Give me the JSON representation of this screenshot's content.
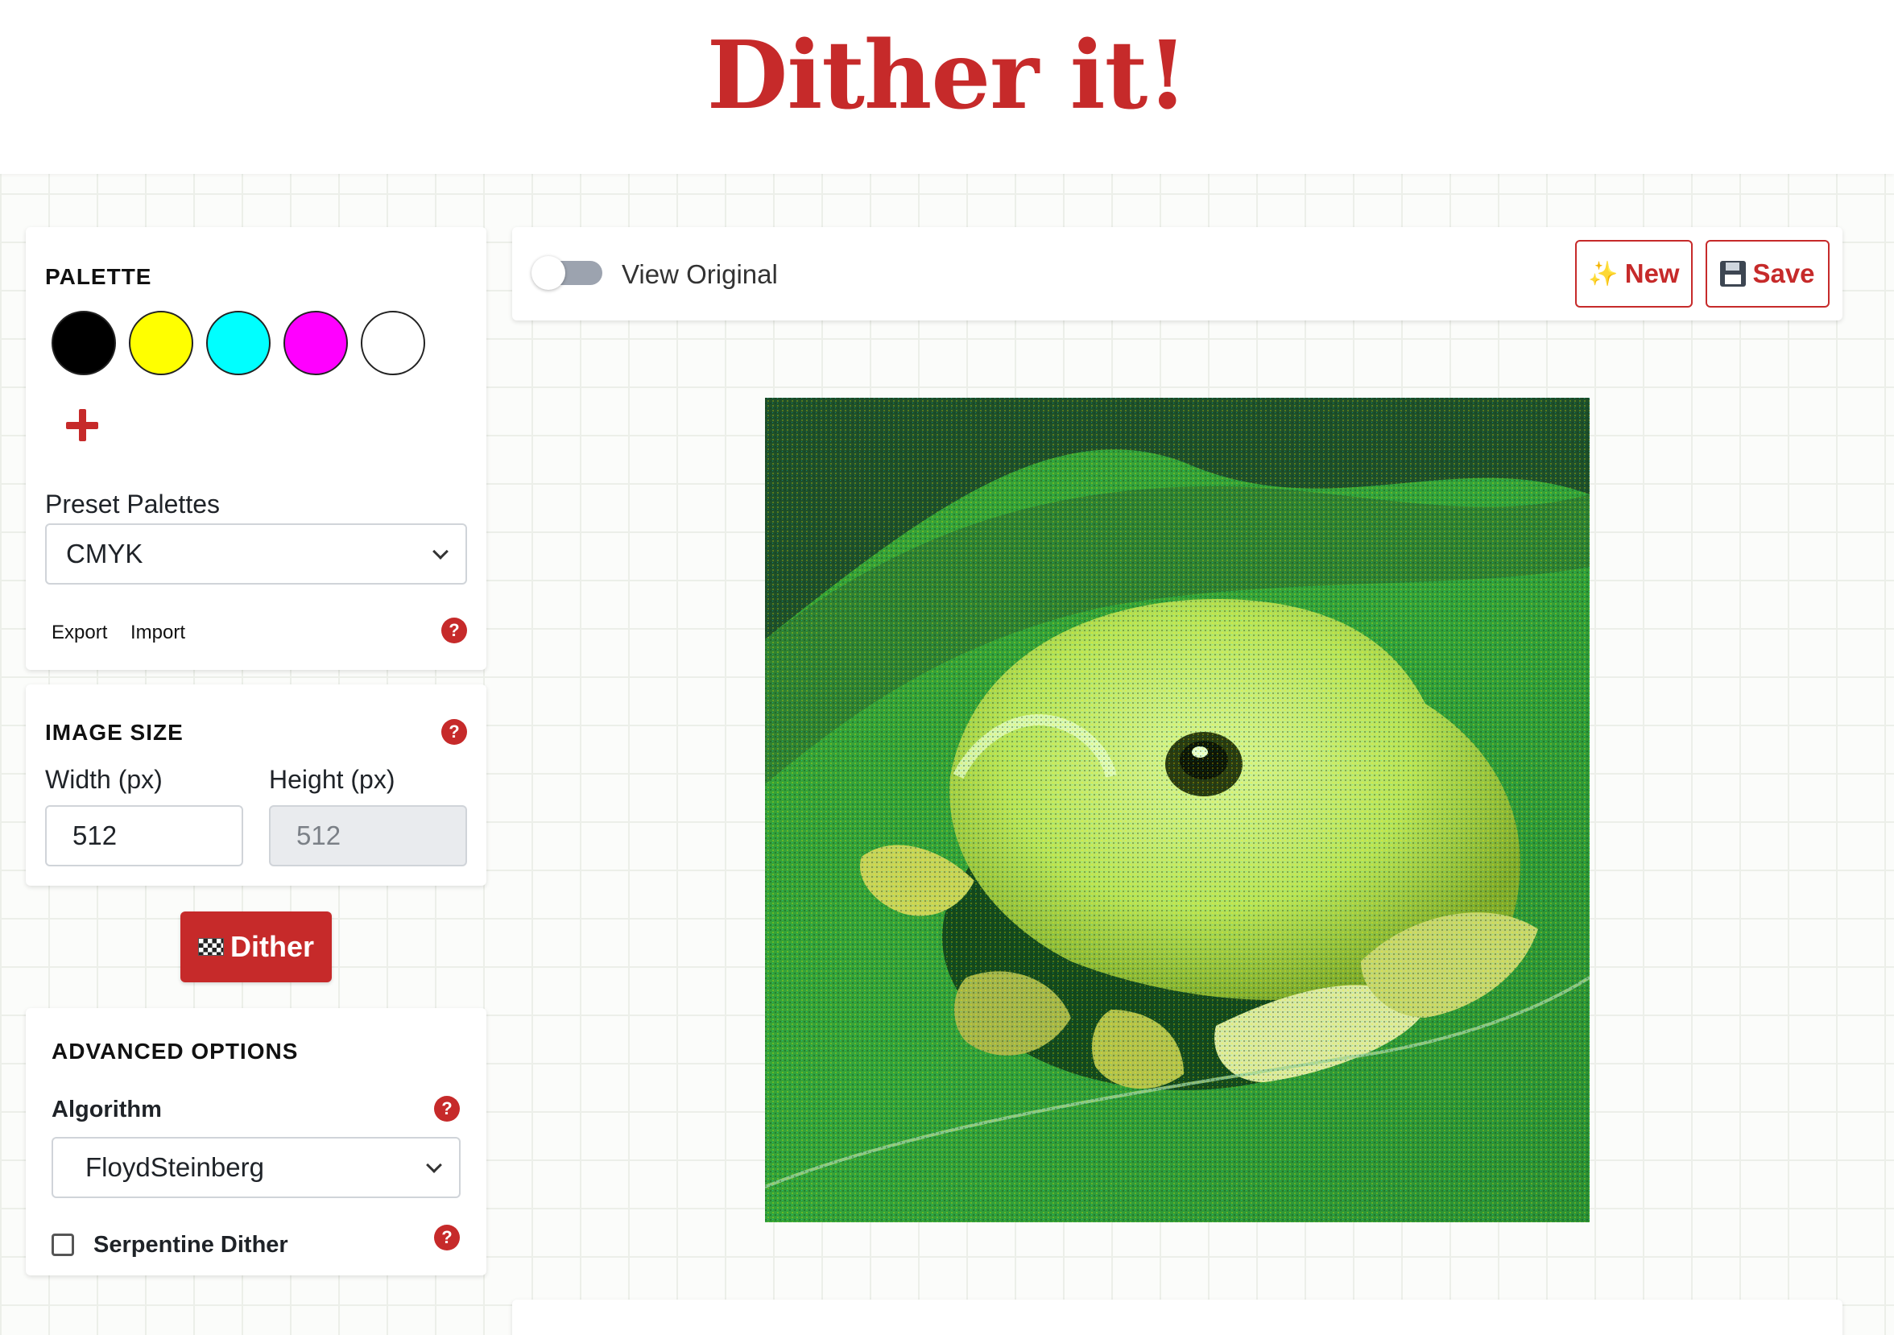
{
  "app": {
    "title": "Dither it!"
  },
  "palette": {
    "heading": "PALETTE",
    "colors": [
      "#000000",
      "#ffff00",
      "#00ffff",
      "#ff00ff",
      "#ffffff"
    ],
    "add_icon": "plus-icon",
    "preset_label": "Preset Palettes",
    "preset_value": "CMYK",
    "export_label": "Export",
    "import_label": "Import",
    "help_glyph": "?"
  },
  "image_size": {
    "heading": "IMAGE SIZE",
    "width_label": "Width (px)",
    "height_label": "Height (px)",
    "width_value": "512",
    "height_value": "512",
    "help_glyph": "?"
  },
  "dither_button": {
    "label": "Dither",
    "icon": "chequered-flag-icon"
  },
  "advanced": {
    "heading": "ADVANCED OPTIONS",
    "algorithm_label": "Algorithm",
    "algorithm_value": "FloydSteinberg",
    "serpentine_label": "Serpentine Dither",
    "serpentine_checked": false,
    "help_glyph": "?"
  },
  "toolbar": {
    "view_original_label": "View Original",
    "view_original_on": false,
    "new_label": "New",
    "new_icon": "sparkles-icon",
    "save_label": "Save",
    "save_icon": "floppy-disk-icon"
  },
  "preview": {
    "subject": "dithered-frog-image"
  },
  "colors": {
    "accent": "#c62a2a",
    "toggle_off": "#9ca3af"
  }
}
